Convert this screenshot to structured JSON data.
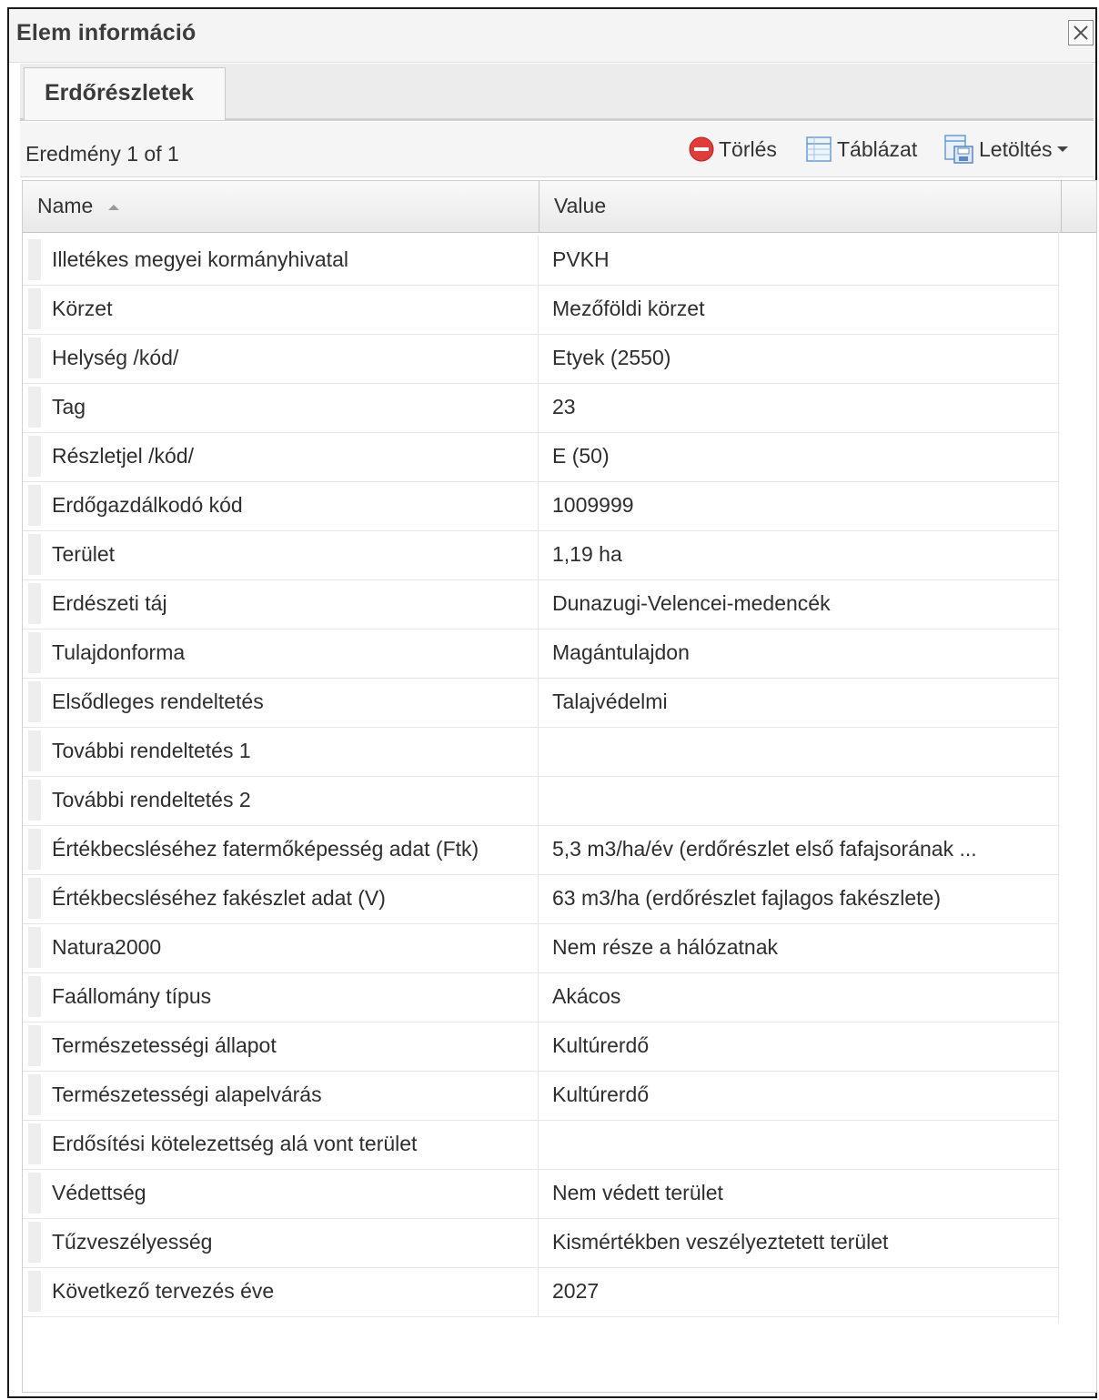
{
  "window": {
    "title": "Elem információ"
  },
  "tabs": [
    {
      "label": "Erdőrészletek"
    }
  ],
  "toolbar": {
    "result_count": "Eredmény 1 of 1",
    "delete_label": "Törlés",
    "table_label": "Táblázat",
    "download_label": "Letöltés"
  },
  "grid": {
    "columns": {
      "name": "Name",
      "value": "Value"
    },
    "rows": [
      {
        "name": "Illetékes megyei kormányhivatal",
        "value": "PVKH"
      },
      {
        "name": "Körzet",
        "value": "Mezőföldi körzet"
      },
      {
        "name": "Helység /kód/",
        "value": "Etyek (2550)"
      },
      {
        "name": "Tag",
        "value": "23"
      },
      {
        "name": "Részletjel /kód/",
        "value": "E (50)"
      },
      {
        "name": "Erdőgazdálkodó kód",
        "value": "1009999"
      },
      {
        "name": "Terület",
        "value": "1,19 ha"
      },
      {
        "name": "Erdészeti táj",
        "value": "Dunazugi-Velencei-medencék"
      },
      {
        "name": "Tulajdonforma",
        "value": "Magántulajdon"
      },
      {
        "name": "Elsődleges rendeltetés",
        "value": "Talajvédelmi"
      },
      {
        "name": "További rendeltetés 1",
        "value": ""
      },
      {
        "name": "További rendeltetés 2",
        "value": ""
      },
      {
        "name": "Értékbecsléséhez fatermőképesség adat (Ftk)",
        "value": "5,3 m3/ha/év (erdőrészlet első fafajsorának ..."
      },
      {
        "name": "Értékbecsléséhez fakészlet adat (V)",
        "value": "63 m3/ha (erdőrészlet fajlagos fakészlete)"
      },
      {
        "name": "Natura2000",
        "value": "Nem része a hálózatnak"
      },
      {
        "name": "Faállomány típus",
        "value": "Akácos"
      },
      {
        "name": "Természetességi állapot",
        "value": "Kultúrerdő"
      },
      {
        "name": "Természetességi alapelvárás",
        "value": "Kultúrerdő"
      },
      {
        "name": "Erdősítési kötelezettség alá vont terület",
        "value": ""
      },
      {
        "name": "Védettség",
        "value": "Nem védett terület"
      },
      {
        "name": "Tűzveszélyesség",
        "value": "Kismértékben veszélyeztetett terület"
      },
      {
        "name": "Következő tervezés éve",
        "value": "2027"
      }
    ]
  },
  "icons": {
    "close": "close-icon",
    "delete": "delete-icon",
    "table": "table-icon",
    "download": "download-icon",
    "sort": "sort-ascending-icon",
    "dropdown": "chevron-down-icon"
  },
  "colors": {
    "delete_red": "#e23b3b",
    "table_blue": "#6b9bd1"
  }
}
